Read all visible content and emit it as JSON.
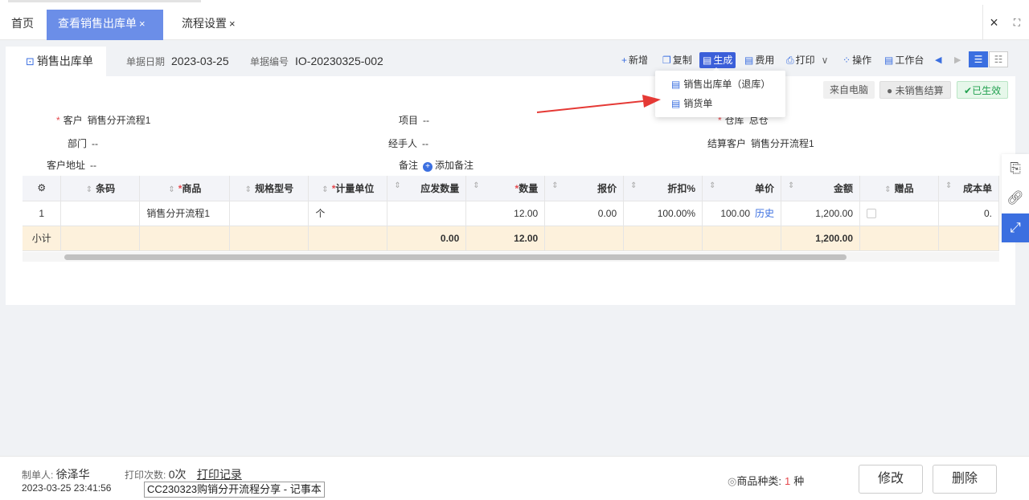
{
  "tabs": {
    "home": "首页",
    "view_outbound": "查看销售出库单",
    "process_settings": "流程设置",
    "close_x": "×"
  },
  "window": {
    "close": "×",
    "expand": "⛶"
  },
  "document": {
    "tab_title": "销售出库单",
    "date_label": "单据日期",
    "date_value": "2023-03-25",
    "no_label": "单据编号",
    "no_value": "IO-20230325-002"
  },
  "toolbar": {
    "new": "新增",
    "copy": "复制",
    "generate": "生成",
    "fee": "费用",
    "print": "打印",
    "operate": "操作",
    "workbench": "工作台"
  },
  "dropdown": {
    "item1": "销售出库单（退库）",
    "item2": "销货单"
  },
  "badges": {
    "source": "来自电脑",
    "settle": "未销售结算",
    "effective": "已生效"
  },
  "fields": {
    "customer_label": "客户",
    "customer_value": "销售分开流程1",
    "project_label": "项目",
    "project_value": "--",
    "warehouse_label": "仓库",
    "warehouse_value": "总仓",
    "dept_label": "部门",
    "dept_value": "--",
    "handler_label": "经手人",
    "handler_value": "--",
    "settle_customer_label": "结算客户",
    "settle_customer_value": "销售分开流程1",
    "address_label": "客户地址",
    "address_value": "--",
    "note_label": "备注",
    "add_note": "添加备注"
  },
  "table": {
    "headers": {
      "barcode": "条码",
      "product": "商品",
      "spec": "规格型号",
      "unit": "计量单位",
      "due_qty": "应发数量",
      "qty": "数量",
      "quote": "报价",
      "discount": "折扣%",
      "price": "单价",
      "amount": "金额",
      "gift": "赠品",
      "cost": "成本单"
    },
    "row": {
      "index": "1",
      "barcode": "",
      "product": "销售分开流程1",
      "spec": "",
      "unit": "个",
      "due_qty": "",
      "qty": "12.00",
      "quote": "0.00",
      "discount": "100.00%",
      "price": "100.00",
      "history": "历史",
      "amount": "1,200.00",
      "cost": "0."
    },
    "subtotal": {
      "label": "小计",
      "due_qty": "0.00",
      "qty": "12.00",
      "amount": "1,200.00"
    }
  },
  "footer": {
    "maker_label": "制单人:",
    "maker_value": "徐泽华",
    "print_count_label": "打印次数:",
    "print_count_value": "0次",
    "print_log": "打印记录",
    "timestamp": "2023-03-25 23:41:56",
    "kinds_label": "商品种类:",
    "kinds_value": "1",
    "kinds_unit": "种",
    "edit": "修改",
    "delete": "删除"
  },
  "tooltip": "CC230323购销分开流程分享 - 记事本",
  "colors": {
    "accent": "#3b6fe0",
    "tab_active": "#6b8ee8",
    "required": "#e5484d",
    "arrow": "#e53935",
    "subtotal_bg": "#fdf1dc"
  }
}
